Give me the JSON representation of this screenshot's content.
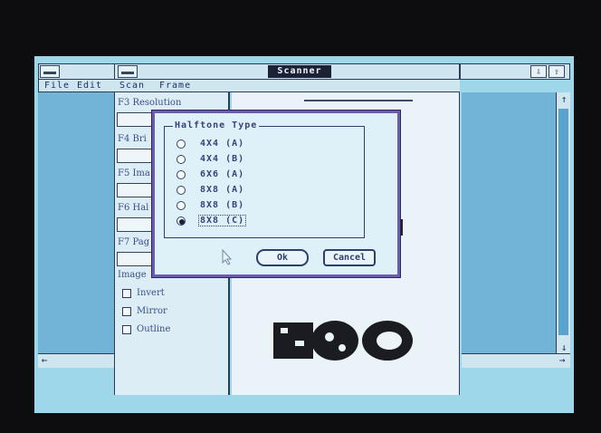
{
  "outer_window": {
    "menu": {
      "file": "File",
      "edit": "Edit"
    }
  },
  "scanner_window": {
    "title": "Scanner",
    "menu": {
      "scan": "Scan",
      "frame": "Frame"
    },
    "panel": {
      "f3": "F3 Resolution",
      "f4": "F4 Bri",
      "f5": "F5 Ima",
      "f6": "F6 Hal",
      "f7": "F7 Pag",
      "image_group": "Image",
      "checkboxes": [
        "Invert",
        "Mirror",
        "Outline"
      ]
    }
  },
  "halftone_dialog": {
    "group_title": "Halftone Type",
    "options": [
      "4X4 (A)",
      "4X4 (B)",
      "6X6 (A)",
      "8X8 (A)",
      "8X8 (B)",
      "8X8 (C)"
    ],
    "selected_index": 5,
    "ok_label": "Ok",
    "cancel_label": "Cancel"
  },
  "icons": {
    "scroll_up": "up-arrow-icon",
    "scroll_down": "down-arrow-icon",
    "scroll_left": "left-arrow-icon",
    "scroll_right": "right-arrow-icon",
    "minimize": "minimize-icon",
    "maximize": "maximize-icon"
  }
}
